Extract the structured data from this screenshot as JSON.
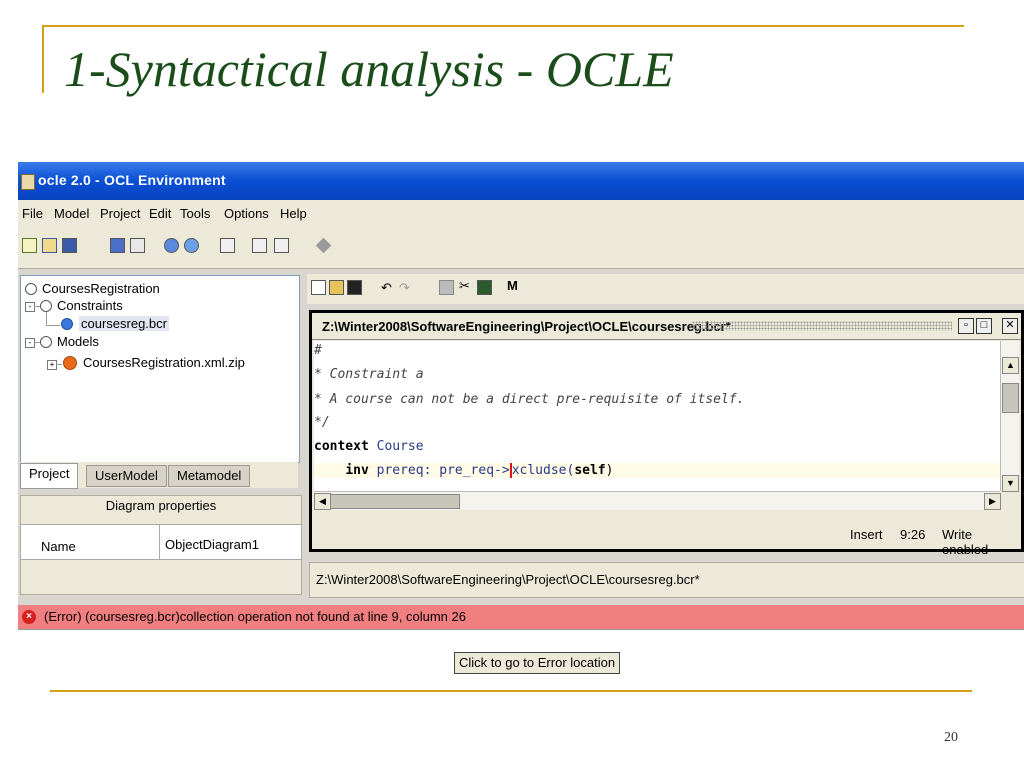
{
  "slide": {
    "title": "1-Syntactical analysis - OCLE",
    "page_number": "20"
  },
  "window": {
    "title": "ocle 2.0 - OCL Environment"
  },
  "menu": [
    "File",
    "Model",
    "Project",
    "Edit",
    "Tools",
    "Options",
    "Help"
  ],
  "tree": {
    "root": "CoursesRegistration",
    "constraints": "Constraints",
    "constraint_file": "coursesreg.bcr",
    "models": "Models",
    "model_file": "CoursesRegistration.xml.zip"
  },
  "tabs": [
    "Project",
    "UserModel",
    "Metamodel"
  ],
  "properties": {
    "header": "Diagram properties",
    "name_label": "Name",
    "name_value": "ObjectDiagram1"
  },
  "editor": {
    "file_path": "Z:\\Winter2008\\SoftwareEngineering\\Project\\OCLE\\coursesreg.bcr*",
    "code": {
      "line1": "#",
      "line2": "* Constraint a",
      "line3": "* A course can not be a direct pre-requisite of itself.",
      "line4": "*/",
      "line5_kw": "context",
      "line5_type": "Course",
      "line6_kw": "inv",
      "line6_a": "prereq: pre_req->",
      "line6_b": "xcludse(",
      "line6_self": "self",
      "line6_c": ")"
    },
    "status": {
      "mode": "Insert",
      "position": "9:26",
      "access": "Write enabled"
    },
    "path_bar": "Z:\\Winter2008\\SoftwareEngineering\\Project\\OCLE\\coursesreg.bcr*"
  },
  "error": {
    "message": "(Error)  (coursesreg.bcr)collection operation not found at line 9, column 26",
    "goto_button": "Click to go to Error location"
  },
  "colors": {
    "title_text": "#1b4d1b",
    "rule": "#d4a017",
    "titlebar": "#0a4fd3",
    "error_bar": "#f27f80"
  }
}
